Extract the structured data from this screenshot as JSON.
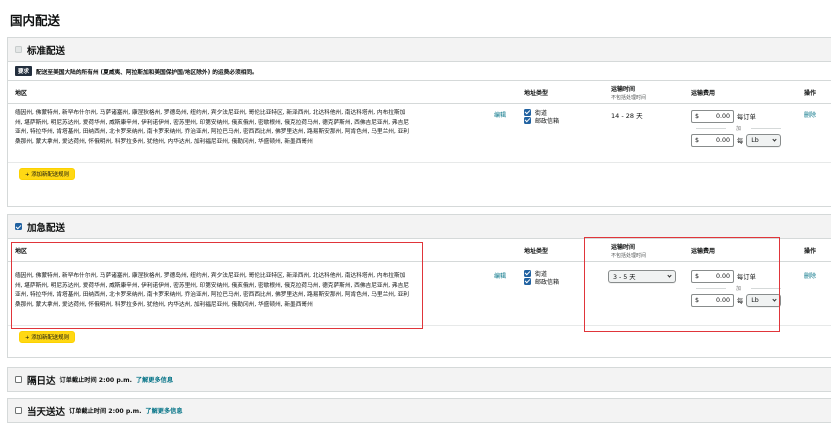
{
  "page": {
    "title": "国内配送"
  },
  "columns": {
    "region": "地区",
    "address_type": "地址类型",
    "transit": "运输时间",
    "transit_sub": "不包括处理时间",
    "fee": "运输费用",
    "action": "操作"
  },
  "region_text": "缅因州, 佛蒙特州, 新罕布什尔州, 马萨诸塞州, 康涅狄格州, 罗德岛州, 纽约州, 宾夕法尼亚州, 哥伦比亚特区, 新泽西州, 北达科他州, 南达科塔州, 内布拉斯加州, 堪萨斯州, 明尼苏达州, 爱荷华州, 威斯康辛州, 伊利诺伊州, 密苏里州, 印第安纳州, 俄亥俄州, 密歇根州, 俄克拉荷马州, 德克萨斯州, 西佛吉尼亚州, 弗吉尼亚州, 特拉华州, 肯塔基州, 田纳西州, 北卡罗来纳州, 南卡罗来纳州, 乔治亚州, 阿拉巴马州, 密西西比州, 佛罗里达州, 路易斯安那州, 阿肯色州, 马里兰州, 亚利桑那州, 蒙大拿州, 爱达荷州, 怀俄明州, 科罗拉多州, 犹他州, 内华达州, 加利福尼亚州, 俄勒冈州, 华盛顿州, 新墨西哥州",
  "standard": {
    "title": "标准配送",
    "badge": "要求",
    "notice": "配送至美国大陆的所有州 (夏威夷、阿拉斯加和美国保护国/地区除外) 的运费必须相同。",
    "edit": "编辑",
    "addr_street": "街道",
    "addr_pobox": "邮政信箱",
    "transit": "14 - 28 天",
    "currency": "$",
    "per_order_amount": "0.00",
    "per_order_label": "每订单",
    "plus": "加",
    "per_unit_amount": "0.00",
    "per_unit_label": "每",
    "unit": "Lb",
    "delete": "删除",
    "add_rule": "+ 添加新配送规则"
  },
  "expedited": {
    "title": "加急配送",
    "edit": "编辑",
    "addr_street": "街道",
    "addr_pobox": "邮政信箱",
    "transit": "3 - 5 天",
    "currency": "$",
    "per_order_amount": "0.00",
    "per_order_label": "每订单",
    "plus": "加",
    "per_unit_amount": "0.00",
    "per_unit_label": "每",
    "unit": "Lb",
    "delete": "删除",
    "add_rule": "+ 添加新配送规则"
  },
  "two_day": {
    "title": "隔日达",
    "cutoff": "订单截止时间 2:00 p.m.",
    "more": "了解更多信息"
  },
  "same_day": {
    "title": "当天送达",
    "cutoff": "订单截止时间 2:00 p.m.",
    "more": "了解更多信息"
  },
  "colors": {
    "accent": "#007185",
    "checkbox": "#2162a1",
    "highlight": "#e0353a",
    "button": "#ffd814"
  }
}
